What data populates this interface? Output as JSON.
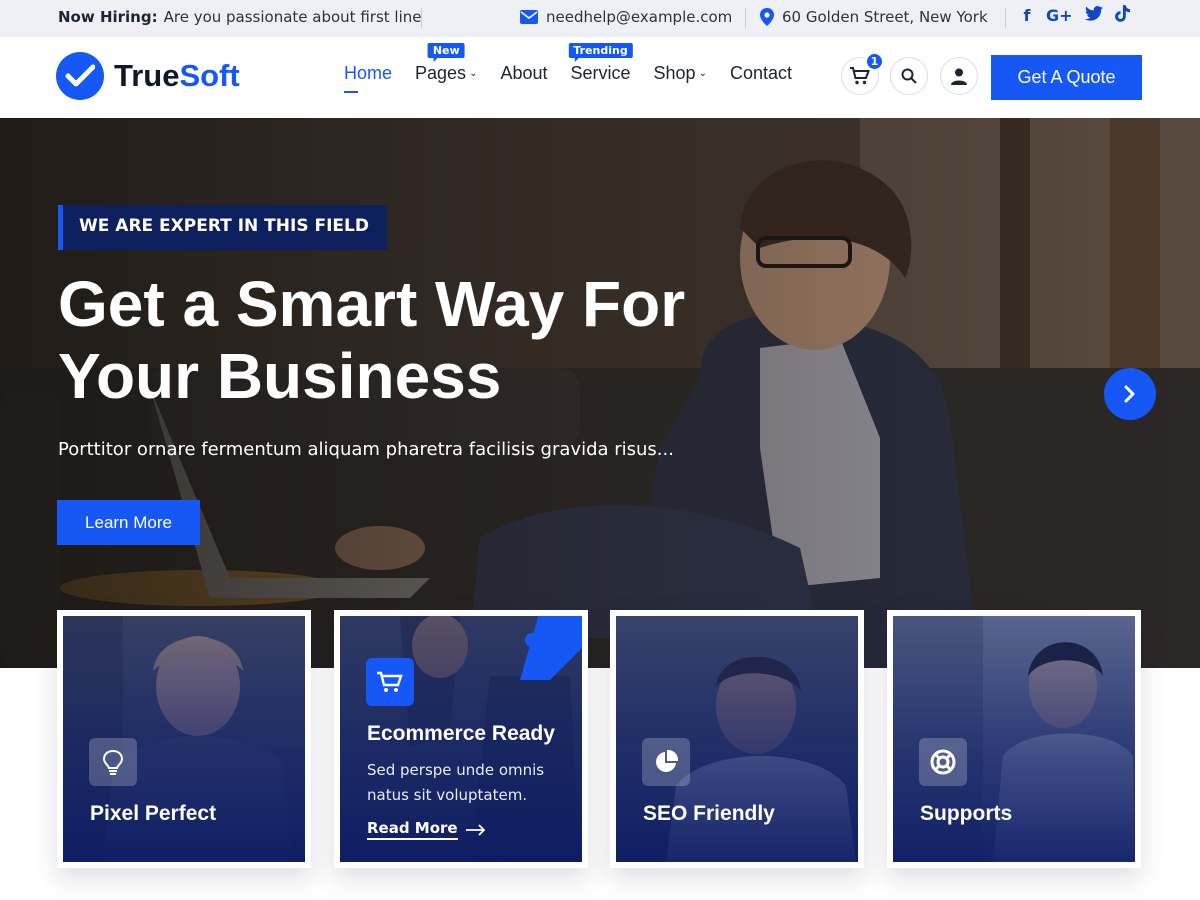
{
  "topbar": {
    "hiring_label": "Now Hiring:",
    "hiring_text": "Are you passionate about first line",
    "email": "needhelp@example.com",
    "address": "60 Golden Street, New York",
    "social": [
      {
        "name": "facebook-icon",
        "glyph": "f"
      },
      {
        "name": "google-plus-icon",
        "glyph": "G+"
      },
      {
        "name": "twitter-icon",
        "glyph": "🐦"
      },
      {
        "name": "tiktok-icon",
        "glyph": "♪"
      }
    ]
  },
  "header": {
    "logo_part1": "True",
    "logo_part2": "Soft",
    "nav": [
      {
        "label": "Home",
        "active": true
      },
      {
        "label": "Pages",
        "badge": "New",
        "dropdown": true
      },
      {
        "label": "About"
      },
      {
        "label": "Service",
        "badge": "Trending"
      },
      {
        "label": "Shop",
        "dropdown": true
      },
      {
        "label": "Contact"
      }
    ],
    "cart_count": "1",
    "quote_label": "Get A Quote"
  },
  "hero": {
    "tag": "WE ARE EXPERT IN THIS FIELD",
    "title_line1": "Get a Smart Way For",
    "title_line2": "Your Business",
    "description": "Porttitor ornare fermentum aliquam pharetra facilisis gravida risus...",
    "button": "Learn More"
  },
  "features": [
    {
      "title": "Pixel Perfect",
      "icon": "lightbulb-icon"
    },
    {
      "title": "Ecommerce Ready",
      "icon": "cart-icon",
      "text": "Sed perspe unde omnis natus sit voluptatem.",
      "link": "Read More"
    },
    {
      "title": "SEO Friendly",
      "icon": "pie-chart-icon"
    },
    {
      "title": "Supports",
      "icon": "lifebuoy-icon"
    }
  ],
  "colors": {
    "primary": "#1558f5",
    "navy": "#0d1f5c",
    "topbar_bg": "#eef0f6"
  }
}
